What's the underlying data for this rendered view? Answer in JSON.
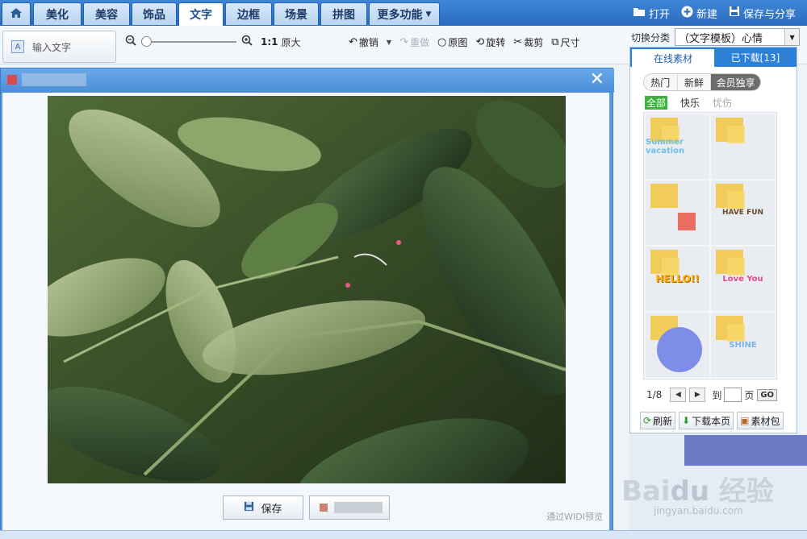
{
  "nav": {
    "tabs": [
      {
        "label": "美化"
      },
      {
        "label": "美容"
      },
      {
        "label": "饰品"
      },
      {
        "label": "文字",
        "active": true
      },
      {
        "label": "边框"
      },
      {
        "label": "场景"
      },
      {
        "label": "拼图"
      },
      {
        "label": "更多功能"
      }
    ],
    "actions": {
      "open": "打开",
      "new": "新建",
      "save_share": "保存与分享"
    }
  },
  "toolbar": {
    "text_input": "输入文字",
    "zoom_ratio": "1:1",
    "zoom_orig": "原大",
    "undo": "撤销",
    "redo": "重做",
    "original": "原图",
    "rotate": "旋转",
    "crop": "裁剪",
    "size": "尺寸"
  },
  "category": {
    "label": "切换分类",
    "value": "（文字模板）心情"
  },
  "panel": {
    "tabs": {
      "online": "在线素材",
      "downloaded": "已下载[13]"
    },
    "filters": [
      "热门",
      "新鲜",
      "会员独享"
    ],
    "subfilters": [
      "全部",
      "快乐",
      "忧伤"
    ],
    "stickers": [
      "Summer vacation",
      "",
      "",
      "HAVE FUN",
      "HELLO!!",
      "Love You",
      "",
      "SHINE"
    ],
    "pager": {
      "current": "1/8",
      "to": "到",
      "page": "页",
      "go": "GO"
    },
    "actions": {
      "refresh": "刷新",
      "download_page": "下载本页",
      "pack": "素材包"
    }
  },
  "dialog": {
    "save": "保存",
    "footnote": "通过WIDI预览"
  },
  "colors": {
    "nav_bg": "#2a6cc0",
    "panel_tab": "#2c80d6",
    "dialog_frame": "#5b9be0"
  }
}
